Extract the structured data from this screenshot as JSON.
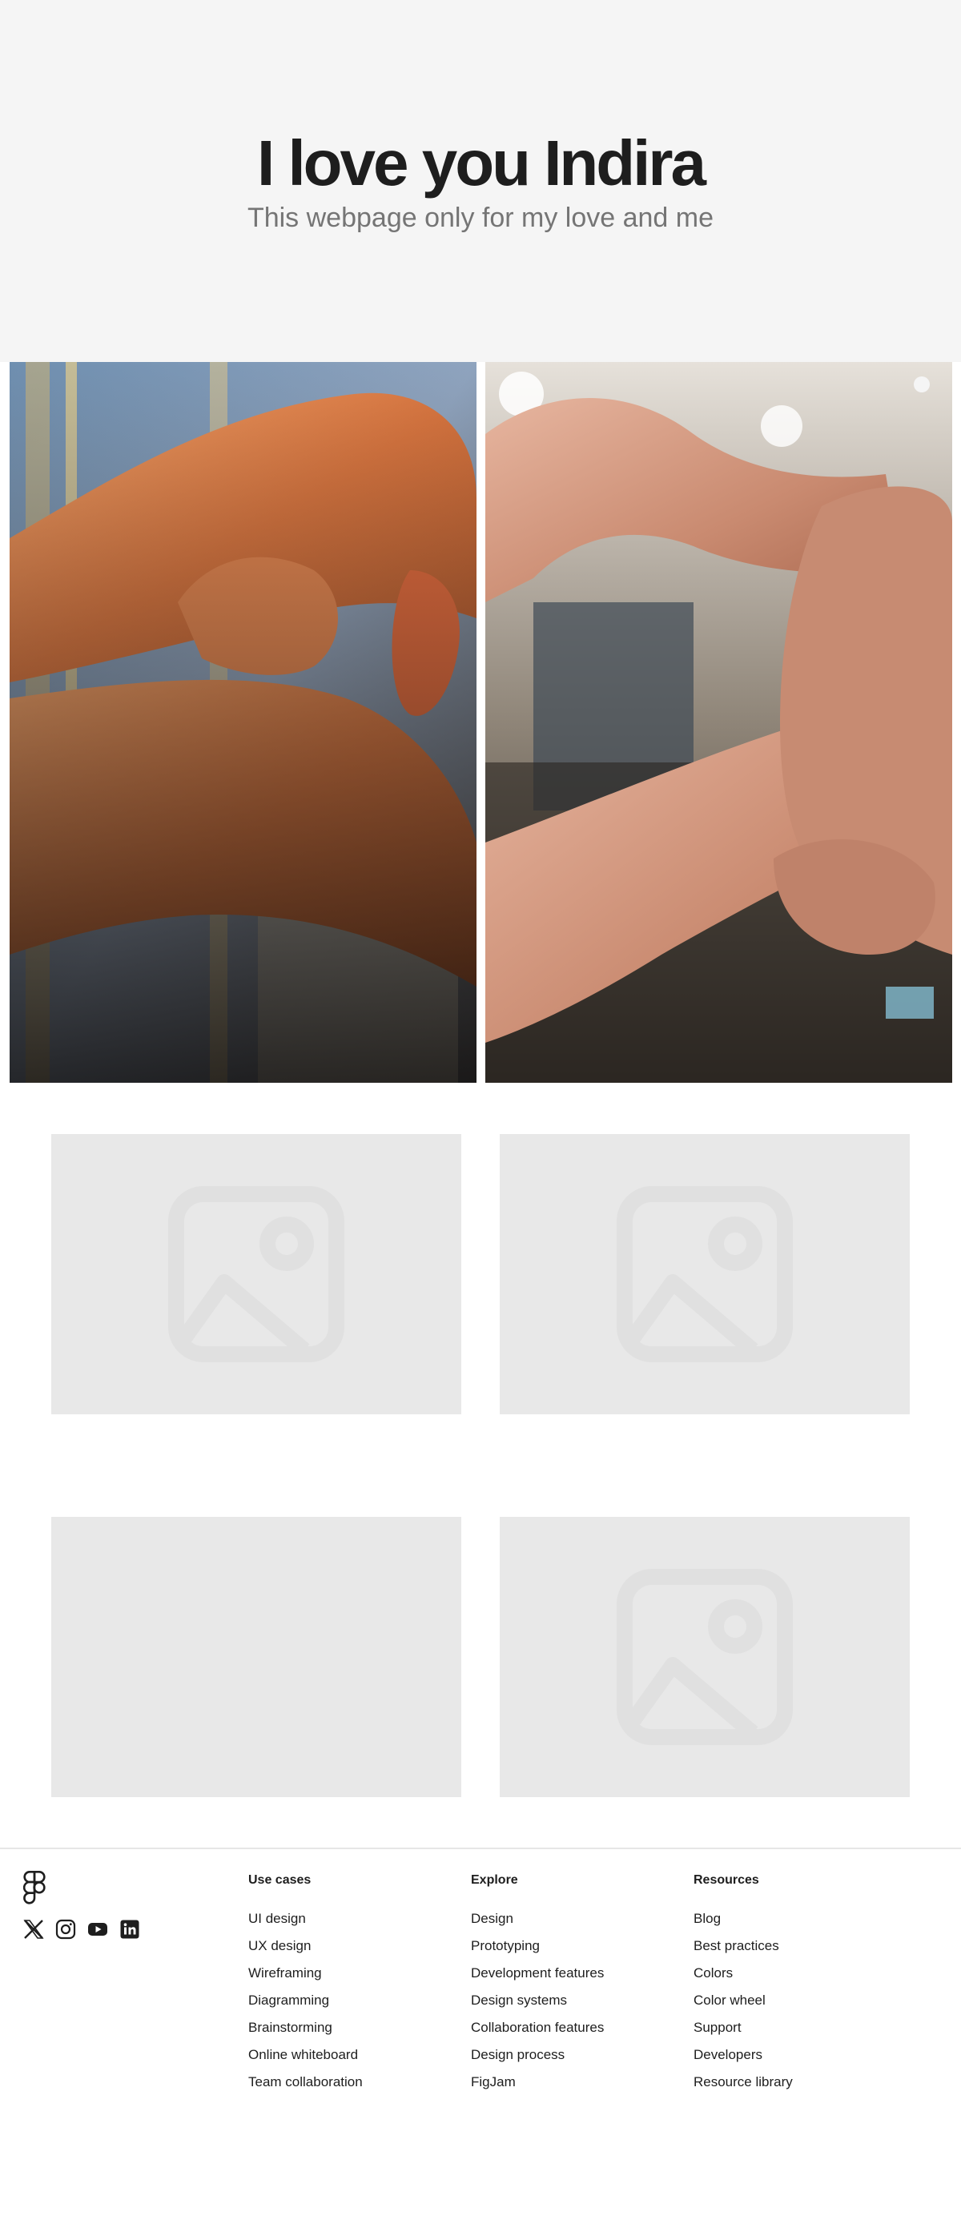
{
  "hero": {
    "title": "I love you Indira",
    "subtitle": "This webpage only for my love and me"
  },
  "gallery": {
    "photos": [
      "photo",
      "photo"
    ],
    "placeholder_icon": "image-placeholder-icon"
  },
  "footer": {
    "logo_icon": "figma-logo-icon",
    "social_icons": [
      "x-icon",
      "instagram-icon",
      "youtube-icon",
      "linkedin-icon"
    ],
    "columns": [
      {
        "heading": "Use cases",
        "links": [
          "UI design",
          "UX design",
          "Wireframing",
          "Diagramming",
          "Brainstorming",
          "Online whiteboard",
          "Team collaboration"
        ]
      },
      {
        "heading": "Explore",
        "links": [
          "Design",
          "Prototyping",
          "Development features",
          "Design systems",
          "Collaboration features",
          "Design process",
          "FigJam"
        ]
      },
      {
        "heading": "Resources",
        "links": [
          "Blog",
          "Best practices",
          "Colors",
          "Color wheel",
          "Support",
          "Developers",
          "Resource library"
        ]
      }
    ]
  },
  "colors": {
    "hero_bg": "#f5f5f5",
    "title": "#1e1e1e",
    "subtitle": "#757575",
    "placeholder_bg": "#e8e8e8"
  }
}
